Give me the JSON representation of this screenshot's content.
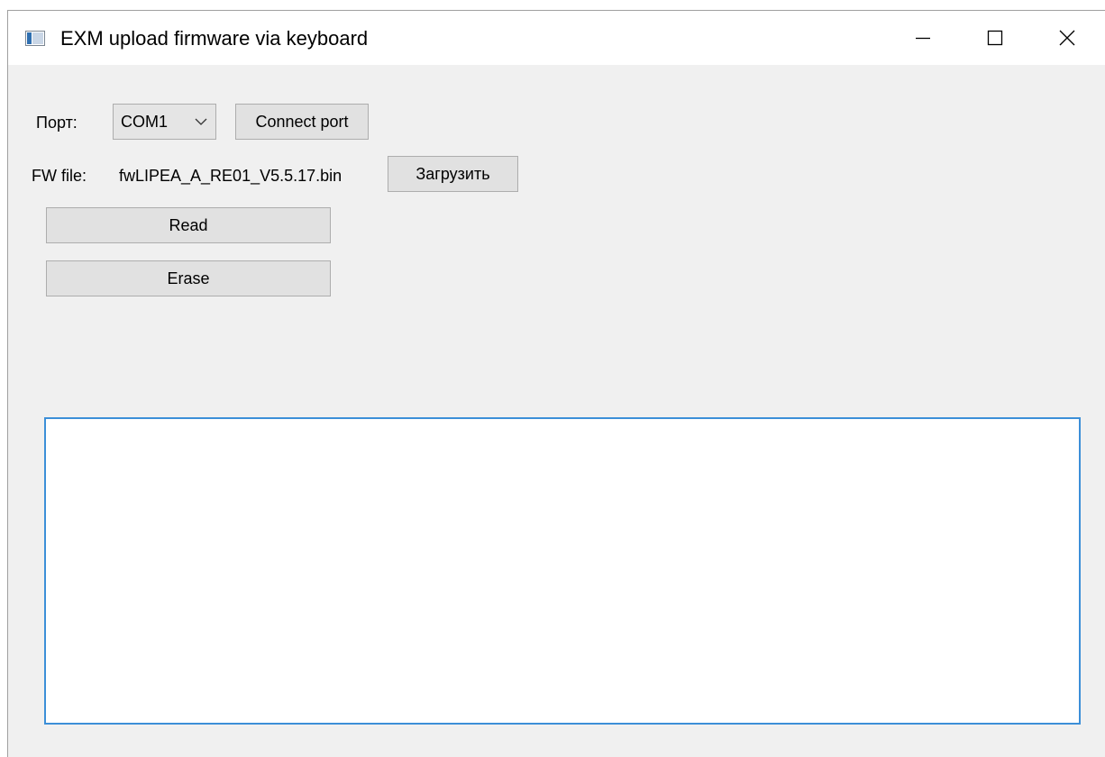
{
  "window": {
    "title": "EXM upload firmware via keyboard"
  },
  "port": {
    "label": "Порт:",
    "selected": "COM1",
    "connect_label": "Connect port"
  },
  "firmware": {
    "label": "FW file:",
    "filename": "fwLIPEA_A_RE01_V5.5.17.bin",
    "load_label": "Загрузить"
  },
  "actions": {
    "read_label": "Read",
    "erase_label": "Erase"
  },
  "log": {
    "content": ""
  },
  "icons": {
    "app": "app-window-icon",
    "minimize": "minimize-icon",
    "maximize": "maximize-icon",
    "close": "close-icon",
    "dropdown": "chevron-down-icon"
  }
}
